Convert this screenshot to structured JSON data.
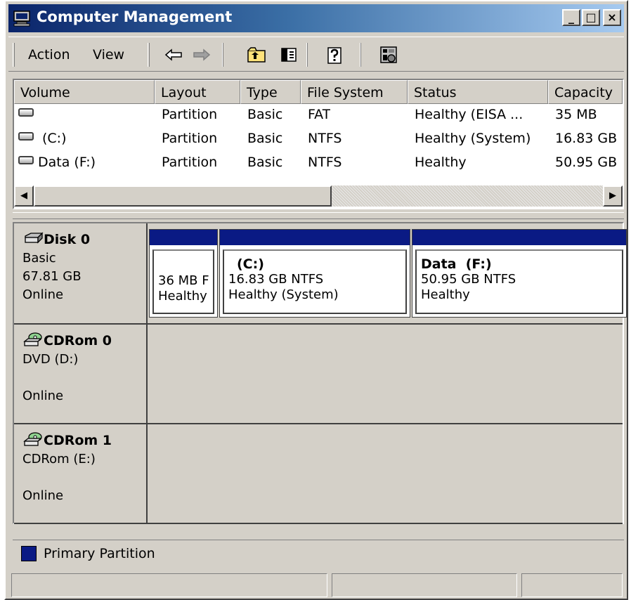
{
  "window": {
    "title": "Computer Management",
    "controls": {
      "minimize": "_",
      "maximize": "□",
      "close": "×"
    }
  },
  "menu": {
    "action": "Action",
    "view": "View"
  },
  "toolbar": {
    "buttons": [
      "back-arrow-icon",
      "forward-arrow-icon",
      "up-folder-icon",
      "show-hide-console-tree-icon",
      "help-icon",
      "properties-icon"
    ]
  },
  "volume_list": {
    "columns": [
      "Volume",
      "Layout",
      "Type",
      "File System",
      "Status",
      "Capacity"
    ],
    "rows": [
      {
        "volume": "",
        "layout": "Partition",
        "type": "Basic",
        "fs": "FAT",
        "status": "Healthy (EISA ...",
        "capacity": "35 MB"
      },
      {
        "volume": "(C:)",
        "layout": "Partition",
        "type": "Basic",
        "fs": "NTFS",
        "status": "Healthy (System)",
        "capacity": "16.83 GB"
      },
      {
        "volume": "Data (F:)",
        "layout": "Partition",
        "type": "Basic",
        "fs": "NTFS",
        "status": "Healthy",
        "capacity": "50.95 GB"
      }
    ]
  },
  "disks": [
    {
      "name": "Disk 0",
      "kind": "Basic",
      "size": "67.81 GB",
      "state": "Online",
      "partitions": [
        {
          "name": "",
          "size_fs": "36 MB F",
          "status": "Healthy"
        },
        {
          "name": "(C:)",
          "size_fs": "16.83 GB NTFS",
          "status": "Healthy (System)"
        },
        {
          "name": "Data  (F:)",
          "size_fs": "50.95 GB NTFS",
          "status": "Healthy"
        }
      ]
    },
    {
      "name": "CDRom 0",
      "drive": "DVD (D:)",
      "state": "Online"
    },
    {
      "name": "CDRom 1",
      "drive": "CDRom (E:)",
      "state": "Online"
    }
  ],
  "legend": {
    "primary_partition": "Primary Partition",
    "color": "#0a1a84"
  },
  "colors": {
    "face": "#d4d0c8",
    "title_start": "#0a246a",
    "title_end": "#a6caf0"
  }
}
